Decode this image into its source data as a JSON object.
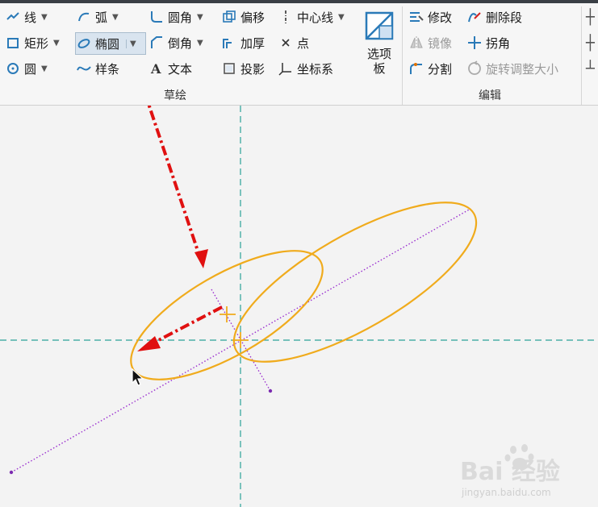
{
  "ribbon": {
    "sketch": {
      "line": "线",
      "rectangle": "矩形",
      "circle": "圆",
      "arc": "弧",
      "ellipse": "椭圆",
      "spline": "样条",
      "fillet": "圆角",
      "chamfer": "倒角",
      "text": "文本",
      "offset": "偏移",
      "thicken": "加厚",
      "project": "投影",
      "centerline": "中心线",
      "point": "点",
      "coord_sys": "坐标系",
      "palette_line1": "选项",
      "palette_line2": "板",
      "group_label": "草绘"
    },
    "edit": {
      "modify": "修改",
      "mirror": "镜像",
      "divide": "分割",
      "delete_segment": "删除段",
      "corner": "拐角",
      "rotate_resize": "旋转调整大小",
      "group_label": "编辑"
    }
  },
  "colors": {
    "ellipse": "#f0ab1c",
    "centerline": "#2aa198",
    "construction": "#9b30d0",
    "annotation_arrow": "#e01010"
  },
  "watermark": {
    "brand": "Bai 经验",
    "url": "jingyan.baidu.com"
  }
}
